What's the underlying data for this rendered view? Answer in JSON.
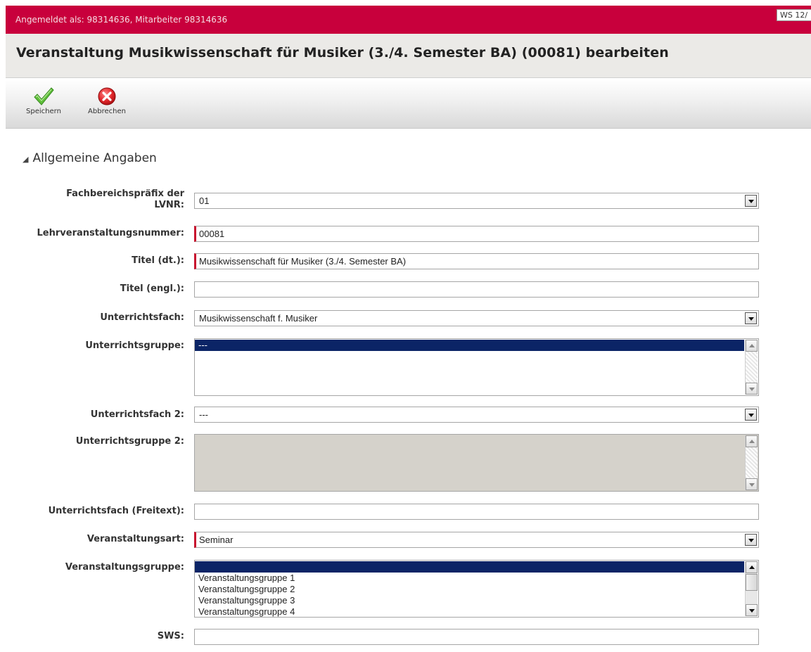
{
  "header": {
    "login_text": "Angemeldet als: 98314636, Mitarbeiter 98314636",
    "semester": "WS 12/"
  },
  "page": {
    "title": "Veranstaltung Musikwissenschaft für Musiker (3./4. Semester BA) (00081) bearbeiten"
  },
  "toolbar": {
    "save_label": "Speichern",
    "cancel_label": "Abbrechen"
  },
  "section": {
    "title": "Allgemeine Angaben"
  },
  "form": {
    "fb_prefix": {
      "label_line1": "Fachbereichspräfix der",
      "label_line2": "LVNR:",
      "value": "01"
    },
    "lv_number": {
      "label": "Lehrveranstaltungsnummer:",
      "value": "00081"
    },
    "title_de": {
      "label": "Titel (dt.):",
      "value": "Musikwissenschaft für Musiker (3./4. Semester BA)"
    },
    "title_en": {
      "label": "Titel (engl.):",
      "value": ""
    },
    "subject": {
      "label": "Unterrichtsfach:",
      "value": "Musikwissenschaft f. Musiker"
    },
    "group": {
      "label": "Unterrichtsgruppe:",
      "items": [
        "---"
      ]
    },
    "subject2": {
      "label": "Unterrichtsfach 2:",
      "value": "---"
    },
    "group2": {
      "label": "Unterrichtsgruppe 2:"
    },
    "subject_free": {
      "label": "Unterrichtsfach (Freitext):",
      "value": ""
    },
    "event_type": {
      "label": "Veranstaltungsart:",
      "value": "Seminar"
    },
    "event_group": {
      "label": "Veranstaltungsgruppe:",
      "items": [
        "",
        "Veranstaltungsgruppe 1",
        "Veranstaltungsgruppe 2",
        "Veranstaltungsgruppe 3",
        "Veranstaltungsgruppe 4"
      ]
    },
    "sws": {
      "label": "SWS:",
      "value": ""
    }
  },
  "colors": {
    "brand_red": "#c8003c",
    "selection_navy": "#0b2466",
    "required_marker": "#c8102e"
  },
  "icons": {
    "save": "checkmark-icon",
    "cancel": "cancel-x-icon"
  }
}
